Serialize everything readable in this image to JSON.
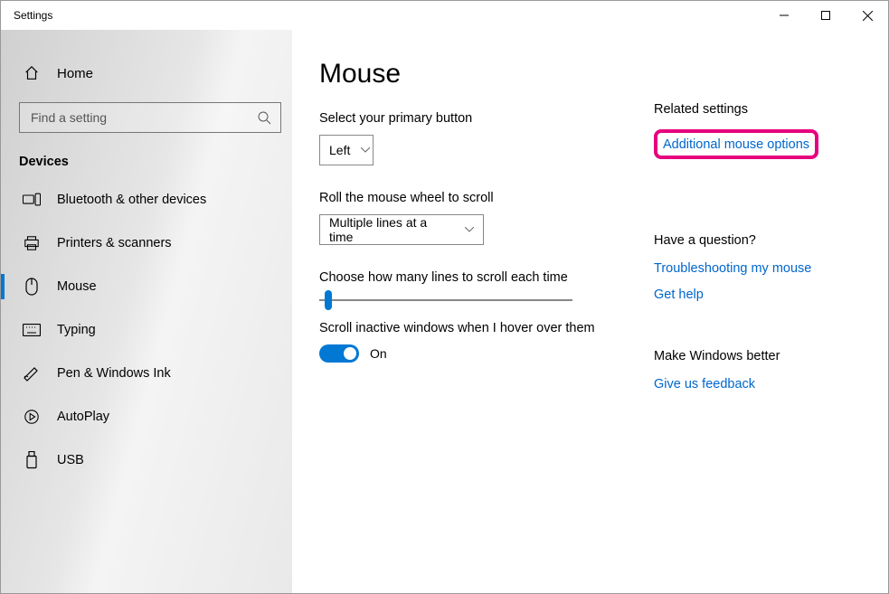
{
  "window": {
    "title": "Settings"
  },
  "sidebar": {
    "home": "Home",
    "search_placeholder": "Find a setting",
    "section": "Devices",
    "items": [
      {
        "label": "Bluetooth & other devices"
      },
      {
        "label": "Printers & scanners"
      },
      {
        "label": "Mouse"
      },
      {
        "label": "Typing"
      },
      {
        "label": "Pen & Windows Ink"
      },
      {
        "label": "AutoPlay"
      },
      {
        "label": "USB"
      }
    ]
  },
  "main": {
    "heading": "Mouse",
    "primary_label": "Select your primary button",
    "primary_value": "Left",
    "wheel_label": "Roll the mouse wheel to scroll",
    "wheel_value": "Multiple lines at a time",
    "lines_label": "Choose how many lines to scroll each time",
    "inactive_label": "Scroll inactive windows when I hover over them",
    "inactive_state": "On"
  },
  "right": {
    "related_title": "Related settings",
    "related_link": "Additional mouse options",
    "question_title": "Have a question?",
    "question_link1": "Troubleshooting my mouse",
    "question_link2": "Get help",
    "better_title": "Make Windows better",
    "better_link": "Give us feedback"
  }
}
